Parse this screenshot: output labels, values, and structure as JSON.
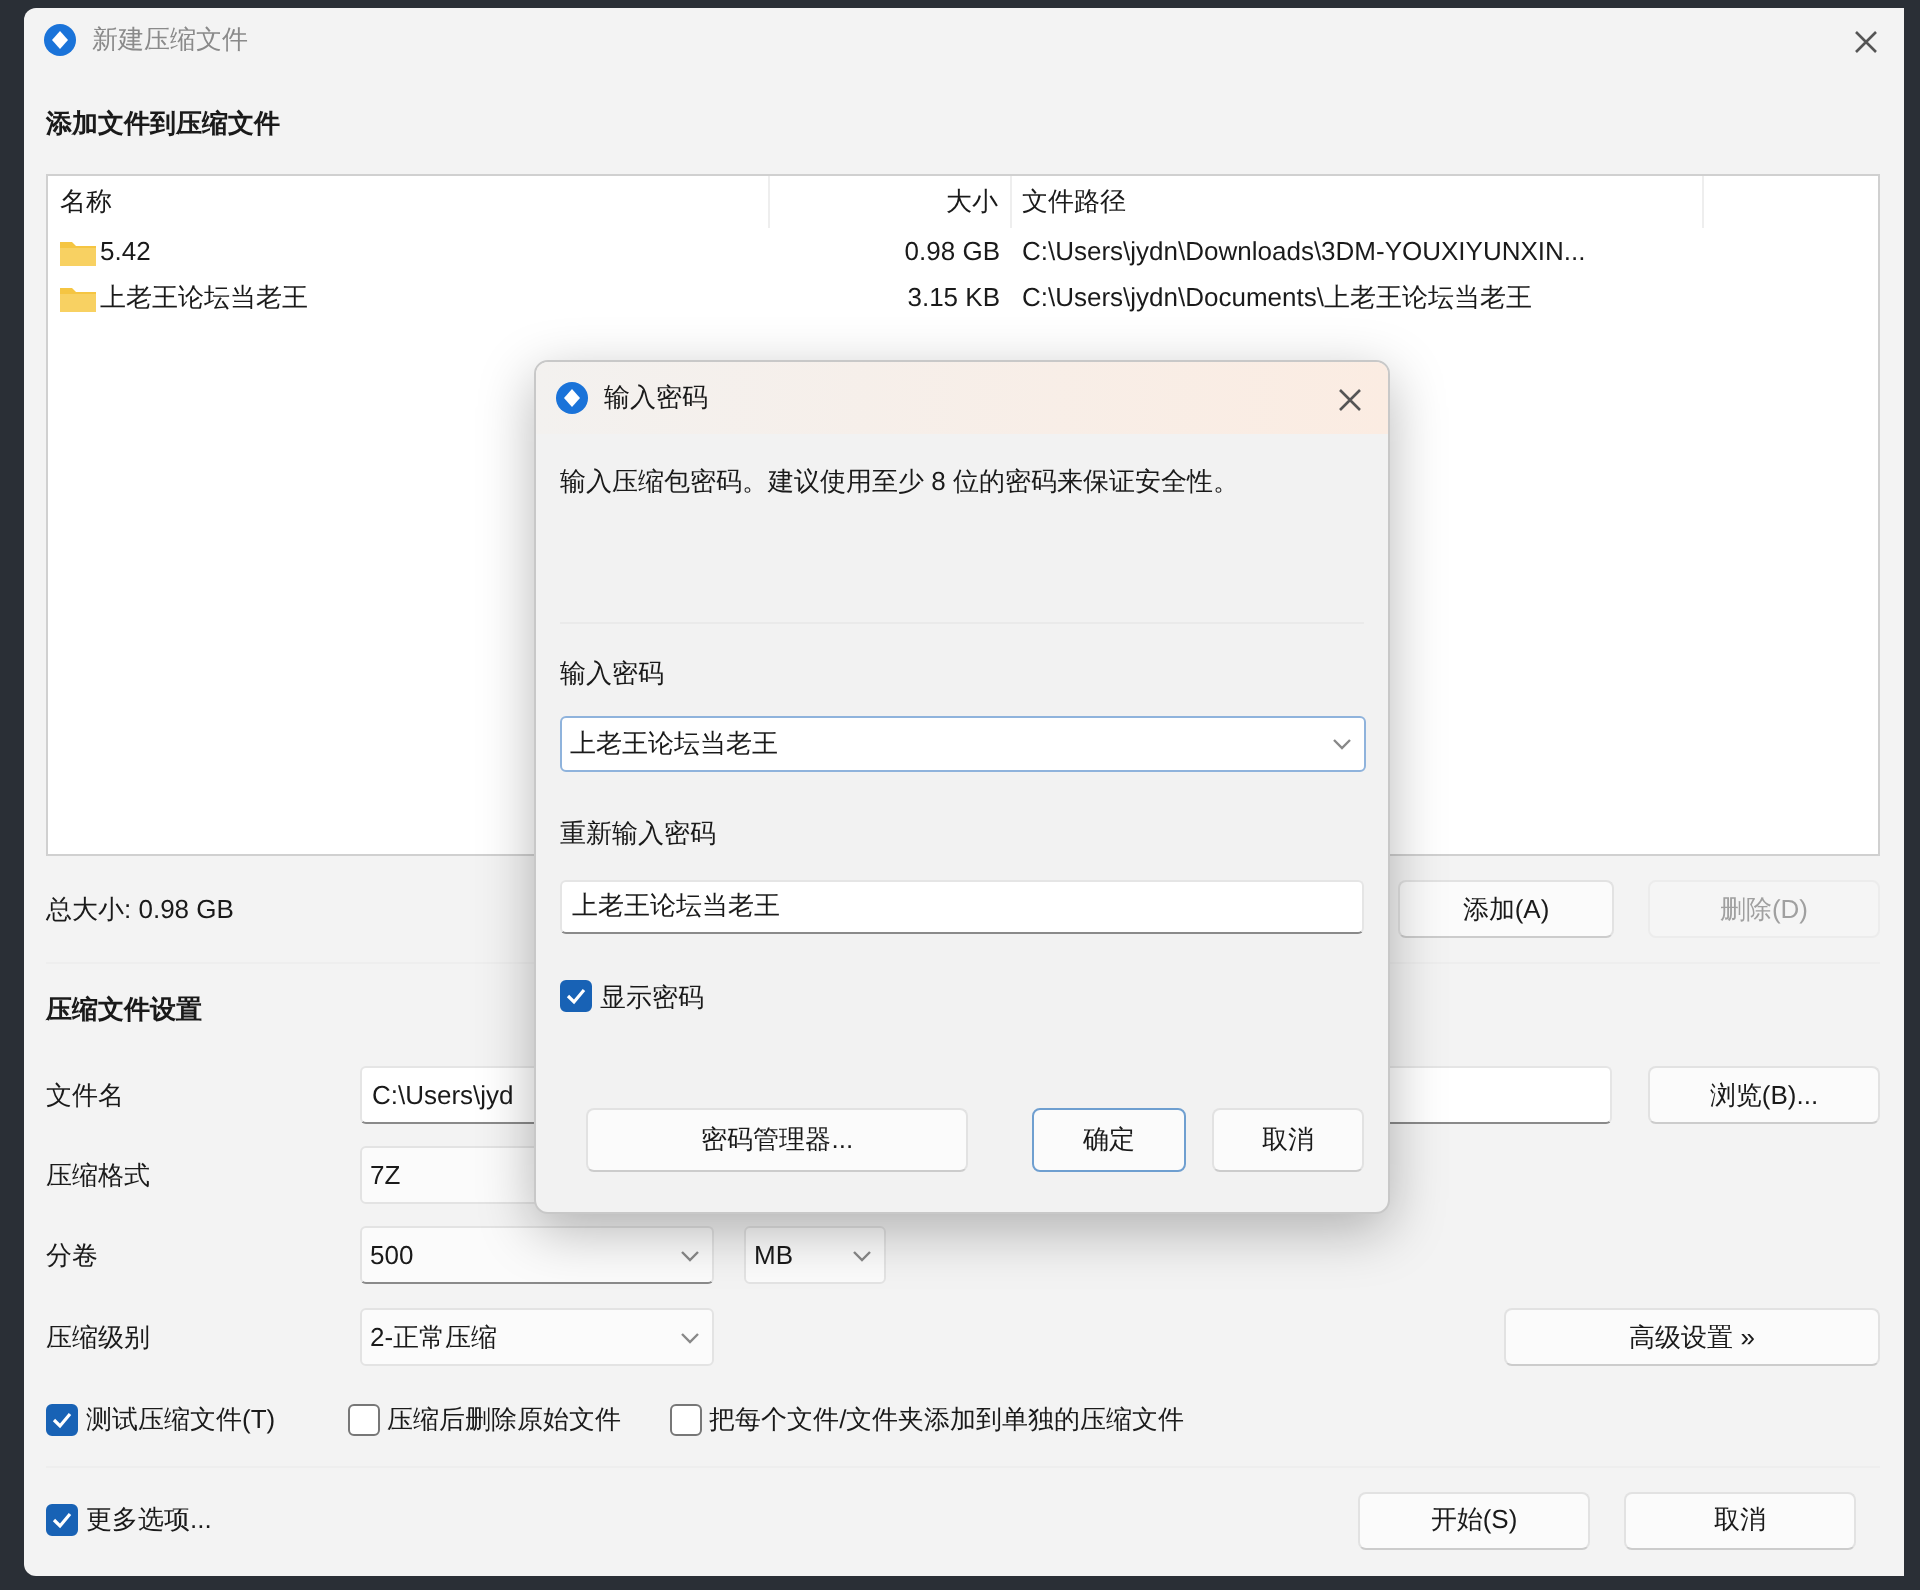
{
  "window": {
    "title": "新建压缩文件"
  },
  "heading": "添加文件到压缩文件",
  "file_list": {
    "columns": [
      "名称",
      "大小",
      "文件路径"
    ],
    "rows": [
      {
        "name": "5.42",
        "size": "0.98 GB",
        "path": "C:\\Users\\jydn\\Downloads\\3DM-YOUXIYUNXIN..."
      },
      {
        "name": "上老王论坛当老王",
        "size": "3.15 KB",
        "path": "C:\\Users\\jydn\\Documents\\上老王论坛当老王"
      }
    ]
  },
  "total_size": "总大小: 0.98 GB",
  "list_buttons": [
    {
      "label": "添加(A)",
      "disabled": false
    },
    {
      "label": "删除(D)",
      "disabled": true
    }
  ],
  "settings": {
    "title": "压缩文件设置",
    "file_name": {
      "label": "文件名",
      "value": "C:\\Users\\jyd"
    },
    "browse_button": "浏览(B)...",
    "format": {
      "label": "压缩格式",
      "value": "7Z"
    },
    "split": {
      "label": "分卷",
      "value": "500",
      "unit": "MB"
    },
    "level": {
      "label": "压缩级别",
      "value": "2-正常压缩"
    },
    "advanced_button": "高级设置 »"
  },
  "options": [
    {
      "label": "测试压缩文件(T)",
      "checked": true
    },
    {
      "label": "压缩后删除原始文件",
      "checked": false
    },
    {
      "label": "把每个文件/文件夹添加到单独的压缩文件",
      "checked": false
    }
  ],
  "more_options": {
    "label": "更多选项...",
    "checked": true
  },
  "footer_buttons": [
    {
      "label": "开始(S)"
    },
    {
      "label": "取消"
    }
  ],
  "password_dialog": {
    "title": "输入密码",
    "message": "输入压缩包密码。建议使用至少 8 位的密码来保证安全性。",
    "password": {
      "label": "输入密码",
      "value": "上老王论坛当老王"
    },
    "confirm": {
      "label": "重新输入密码",
      "value": "上老王论坛当老王"
    },
    "show_password": {
      "label": "显示密码",
      "checked": true
    },
    "buttons": [
      {
        "label": "密码管理器...",
        "default": false
      },
      {
        "label": "确定",
        "default": true
      },
      {
        "label": "取消",
        "default": false
      }
    ]
  }
}
